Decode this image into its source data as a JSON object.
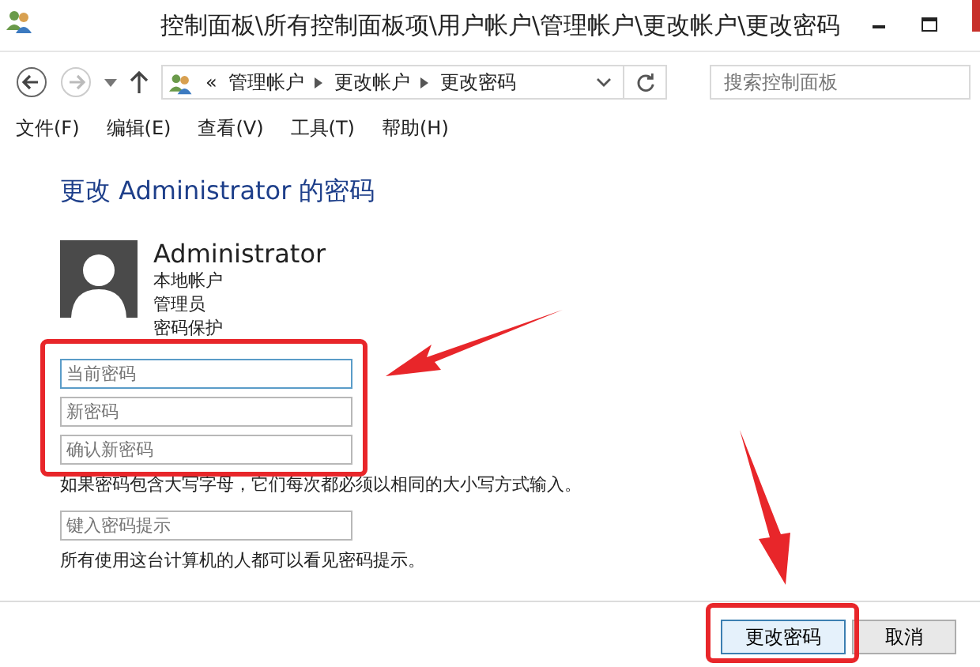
{
  "window": {
    "title": "控制面板\\所有控制面板项\\用户帐户\\管理帐户\\更改帐户\\更改密码"
  },
  "address_bar": {
    "overflow": "«",
    "crumbs": [
      "管理帐户",
      "更改帐户",
      "更改密码"
    ]
  },
  "search": {
    "placeholder": "搜索控制面板"
  },
  "menu": [
    "文件(F)",
    "编辑(E)",
    "查看(V)",
    "工具(T)",
    "帮助(H)"
  ],
  "heading": "更改 Administrator 的密码",
  "account": {
    "name": "Administrator",
    "details": [
      "本地帐户",
      "管理员",
      "密码保护"
    ]
  },
  "password_fields": [
    {
      "placeholder": "当前密码",
      "focused": true
    },
    {
      "placeholder": "新密码",
      "focused": false
    },
    {
      "placeholder": "确认新密码",
      "focused": false
    }
  ],
  "case_note": "如果密码包含大写字母，它们每次都必须以相同的大小写方式输入。",
  "hint_field": {
    "placeholder": "键入密码提示"
  },
  "hint_note": "所有使用这台计算机的人都可以看见密码提示。",
  "buttons": [
    {
      "label": "更改密码",
      "kind": "primary"
    },
    {
      "label": "取消",
      "kind": "normal"
    }
  ]
}
